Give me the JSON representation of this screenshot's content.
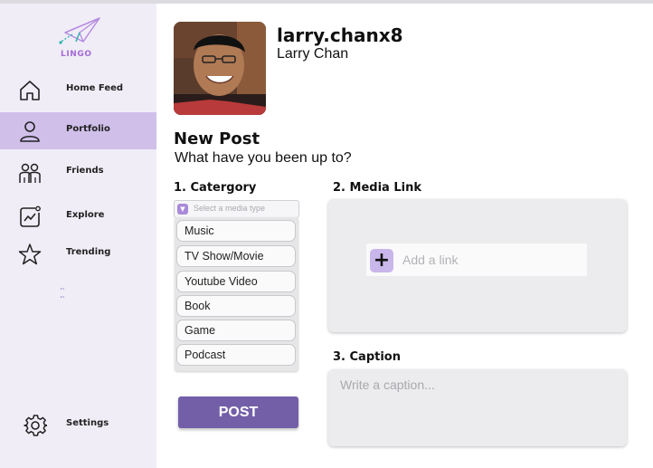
{
  "brand": {
    "name": "LINGO"
  },
  "sidebar": {
    "items": [
      {
        "label": "Home Feed",
        "icon": "home-icon"
      },
      {
        "label": "Portfolio",
        "icon": "user-icon",
        "active": true
      },
      {
        "label": "Friends",
        "icon": "friends-icon"
      },
      {
        "label": "Explore",
        "icon": "explore-chart-icon"
      },
      {
        "label": "Trending",
        "icon": "star-icon"
      }
    ],
    "settings": {
      "label": "Settings",
      "icon": "gear-icon"
    }
  },
  "profile": {
    "username": "larry.chanx8",
    "full_name": "Larry Chan"
  },
  "post": {
    "heading": "New Post",
    "prompt": "What have you been up to?",
    "category": {
      "title": "1. Catergory",
      "placeholder": "Select a media type",
      "options": [
        "Music",
        "TV Show/Movie",
        "Youtube Video",
        "Book",
        "Game",
        "Podcast"
      ]
    },
    "media": {
      "title": "2. Media Link",
      "placeholder": "Add a link",
      "add_label": "+"
    },
    "caption": {
      "title": "3. Caption",
      "placeholder": "Write a caption..."
    },
    "submit_label": "POST"
  },
  "colors": {
    "accent": "#735fa8",
    "sidebar_bg": "#f0edf7",
    "active_bg": "#cfbfe9",
    "logo": "#a46ad6"
  }
}
